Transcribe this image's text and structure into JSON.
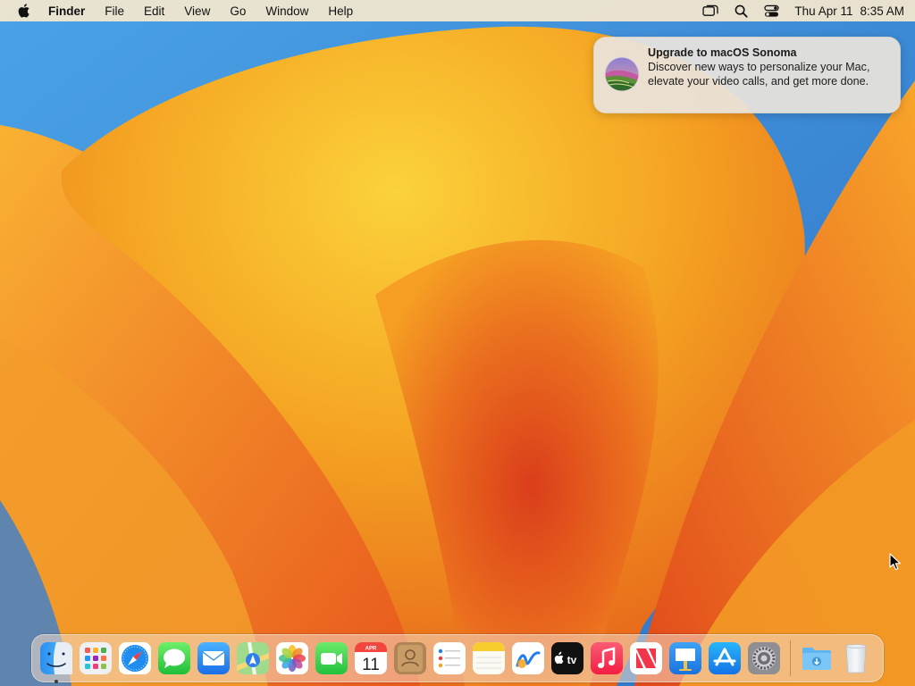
{
  "menubar": {
    "app_name": "Finder",
    "menus": [
      "File",
      "Edit",
      "View",
      "Go",
      "Window",
      "Help"
    ],
    "status_icons": [
      "screen-mirroring-icon",
      "spotlight-search-icon",
      "control-center-icon"
    ],
    "clock": {
      "day": "Thu Apr 11",
      "time": "8:35 AM"
    }
  },
  "notification": {
    "title": "Upgrade to macOS Sonoma",
    "body": "Discover new ways to personalize your Mac, elevate your video calls, and get more done.",
    "icon": "macos-sonoma-icon"
  },
  "dock": {
    "apps": [
      {
        "icon": "finder-icon",
        "running": true
      },
      {
        "icon": "launchpad-icon",
        "running": false
      },
      {
        "icon": "safari-icon",
        "running": false
      },
      {
        "icon": "messages-icon",
        "running": false
      },
      {
        "icon": "mail-icon",
        "running": false
      },
      {
        "icon": "maps-icon",
        "running": false
      },
      {
        "icon": "photos-icon",
        "running": false
      },
      {
        "icon": "facetime-icon",
        "running": false
      },
      {
        "icon": "calendar-icon",
        "running": false
      },
      {
        "icon": "contacts-icon",
        "running": false
      },
      {
        "icon": "reminders-icon",
        "running": false
      },
      {
        "icon": "notes-icon",
        "running": false
      },
      {
        "icon": "freeform-icon",
        "running": false
      },
      {
        "icon": "apple-tv-icon",
        "running": false
      },
      {
        "icon": "music-icon",
        "running": false
      },
      {
        "icon": "news-icon",
        "running": false
      },
      {
        "icon": "keynote-icon",
        "running": false
      },
      {
        "icon": "app-store-icon",
        "running": false
      },
      {
        "icon": "system-settings-icon",
        "running": false
      }
    ],
    "calendar": {
      "month": "APR",
      "day": "11"
    },
    "tv_label": "tv",
    "extras": [
      {
        "icon": "downloads-folder-icon"
      },
      {
        "icon": "trash-icon"
      }
    ]
  },
  "colors": {
    "wallpaper_sky": "#3f8fd8",
    "wallpaper_orange": "#f29a1c",
    "wallpaper_red": "#d9421a",
    "menubar_bg": "#f6e8ce"
  }
}
